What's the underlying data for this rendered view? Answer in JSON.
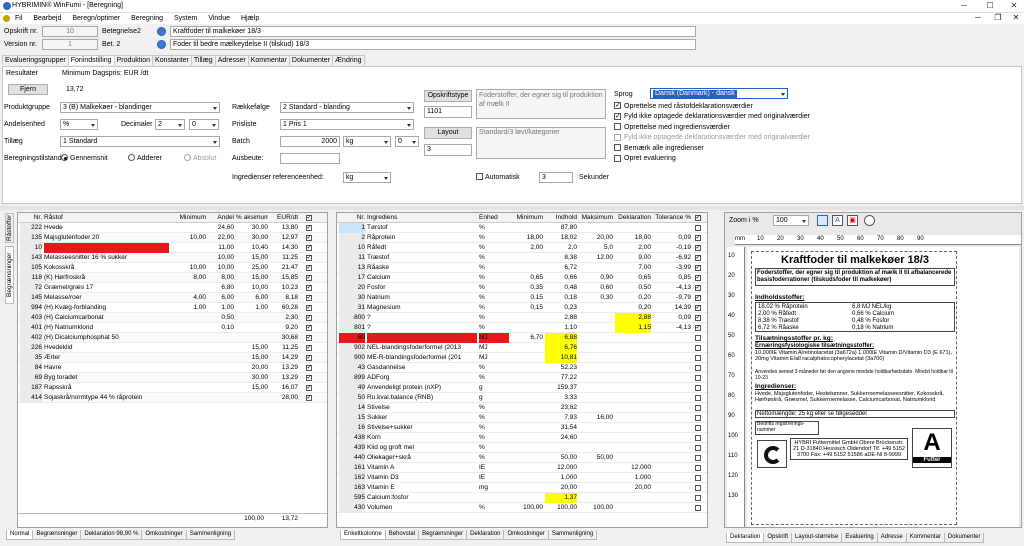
{
  "app": {
    "title": "HYBRIMIN® WinFumi - [Beregning]"
  },
  "menu": [
    "Fil",
    "Bearbejd",
    "Beregn/optimer",
    "Beregning",
    "System",
    "Vindue",
    "Hjælp"
  ],
  "header": {
    "opskrift_label": "Opskrift nr.",
    "opskrift_value": "10",
    "version_label": "Version nr.",
    "version_value": "1",
    "betegnelse2_label": "Betegnelse2",
    "betegnelse2_value": "Kraftfoder til malkekøer 18/3",
    "bet2_label": "Bet. 2",
    "bet2_value": "Foder til bedre mælkeydelse II (tilskud) 18/3"
  },
  "tabs": [
    "Evalueringsgrupper",
    "Foriindstilling",
    "Produktion",
    "Konstanter",
    "Tillæg",
    "Adresser",
    "Kommentar",
    "Dokumenter",
    "Ændring"
  ],
  "results": {
    "resultater_label": "Resultater",
    "min_price_label": "Minimum Dagspris: EUR /dt",
    "fjern_label": "Fjern",
    "price_value": "13,72"
  },
  "settings": {
    "produktgruppe_label": "Produktgruppe",
    "produktgruppe_value": "3 (B) Malkekøer - blandinger",
    "andelsenhed_label": "Andelsenhed",
    "andelsenhed_value": "%",
    "decimaler_label": "Decimaler",
    "decimaler_value": "2",
    "decimaler_value2": "0",
    "tillaeg_label": "Tillæg",
    "tillaeg_value": "1 Standard",
    "beregningstilstand_label": "Beregningstilstand",
    "radio_gennemsnit": "Gennemsnit",
    "radio_adderer": "Adderer",
    "radio_absolut": "Absolut",
    "raekkefolge_label": "Rækkefølge",
    "raekkefolge_value": "2 Standard - blanding",
    "prisliste_label": "Prisliste",
    "prisliste_value": "1 Pris 1",
    "batch_label": "Batch",
    "batch_value": "2000",
    "batch_unit": "kg",
    "batch_extra": "0",
    "ausbeute_label": "Ausbeute:",
    "ingred_ref_label": "Ingredienser referenceenhed:",
    "ingred_ref_value": "kg",
    "opskriftstype_label": "Opskriftstype",
    "opskriftstype_value": "1101",
    "layout_label": "Layout",
    "layout_value": "3",
    "desc1": "Foderstoffer, der egner sig til produktion af mælk II",
    "desc2": "Standard/3 løvt/kategorier",
    "automatisk_label": "Automatisk",
    "sekunder_value": "3",
    "sekunder_label": "Sekunder",
    "sprog_label": "Sprog",
    "sprog_value": "Dansk (Danmark) - dansk",
    "options": [
      {
        "label": "Oprettelse med råstofdeklarationsværdier",
        "checked": true
      },
      {
        "label": "Fyld ikke optagede deklarationsværdier med originalværdier",
        "checked": true
      },
      {
        "label": "Oprettelse med ingrediensværdier",
        "checked": false
      },
      {
        "label": "Fyld ikke optagede deklarationsværdier med originalværdier",
        "checked": false,
        "disabled": true
      },
      {
        "label": "Bemærk alle ingredienser",
        "checked": false
      },
      {
        "label": "Opret evaluering",
        "checked": false
      }
    ]
  },
  "raw_table": {
    "headers": [
      "Nr.",
      "Råstof",
      "Minimum",
      "Andel",
      "% aksimum",
      "EUR/dt"
    ],
    "rows": [
      [
        "222",
        "Hvede",
        "",
        "24,60",
        "30,00",
        "13,80"
      ],
      [
        "135",
        "Majsglutenfoder 20",
        "10,00",
        "22,00",
        "30,00",
        "12,97"
      ],
      [
        "10",
        "",
        "",
        "11,00",
        "10,40",
        "14,30"
      ],
      [
        "143",
        "Melasseesnitter 16 % sukker",
        "",
        "10,00",
        "15,00",
        "11,25"
      ],
      [
        "105",
        "Kokosskrå",
        "10,00",
        "10,00",
        "25,00",
        "21,47"
      ],
      [
        "118",
        "(K) Hørfroskrå",
        "8,00",
        "8,00",
        "15,00",
        "15,85"
      ],
      [
        "72",
        "Græmel/græs 17",
        "",
        "6,80",
        "10,00",
        "10,23"
      ],
      [
        "145",
        "Melasse/roer",
        "4,00",
        "6,00",
        "6,00",
        "8,18"
      ],
      [
        "994",
        "(H) Kvæg-forblanding",
        "1,00",
        "1,00",
        "1,00",
        "60,28"
      ],
      [
        "403",
        "(H) Calciumcarbonat",
        "",
        "0,50",
        "",
        "2,30"
      ],
      [
        "401",
        "(H) Natriumklorid",
        "",
        "0,10",
        "",
        "9,20"
      ],
      [
        "402",
        "(H) Dicalciumphosphat 50",
        "",
        "",
        "",
        "30,68"
      ],
      [
        "226",
        "Hvedeklid",
        "",
        "",
        "15,00",
        "11,25"
      ],
      [
        "35",
        "Ærter",
        "",
        "",
        "15,00",
        "14,29"
      ],
      [
        "84",
        "Havre",
        "",
        "",
        "20,00",
        "13,29"
      ],
      [
        "69",
        "Byg toradet",
        "",
        "",
        "30,00",
        "13,29"
      ],
      [
        "187",
        "Rapsskrå",
        "",
        "",
        "15,00",
        "16,07"
      ],
      [
        "414",
        "Sojaskrå/normtype 44 % råprotein",
        "",
        "",
        "",
        "28,00"
      ]
    ],
    "total_andel": "100,00",
    "total_price": "13,72",
    "bottom_tabs": [
      "Normal",
      "Begrænsninger",
      "Deklaration 98,90 %",
      "Omkostninger",
      "Sammenligning"
    ],
    "side_tabs": [
      "Råstoffer",
      "Begrænsninger"
    ]
  },
  "ingred_table": {
    "headers": [
      "Nr.",
      "Ingrediens",
      "Enhed",
      "Minimum",
      "Indhold",
      "Maksimum",
      "Deklaration",
      "Tolerance %"
    ],
    "rows": [
      [
        "1",
        "Tørstof",
        "%",
        "",
        "87,80",
        "",
        "",
        ""
      ],
      [
        "2",
        "Råprotein",
        "%",
        "18,00",
        "18,02",
        "20,00",
        "18,00",
        "0,09"
      ],
      [
        "10",
        "Råfedt",
        "%",
        "2,00",
        "2,0",
        "5,0",
        "2,00",
        "-0,19"
      ],
      [
        "11",
        "Træstof",
        "%",
        "",
        "8,38",
        "12,00",
        "9,00",
        "-6,92"
      ],
      [
        "13",
        "Råaske",
        "%",
        "",
        "6,72",
        "",
        "7,00",
        "-3,99"
      ],
      [
        "17",
        "Calcium",
        "%",
        "0,65",
        "0,66",
        "0,90",
        "0,65",
        "0,85"
      ],
      [
        "20",
        "Fosfor",
        "%",
        "0,35",
        "0,48",
        "0,60",
        "0,50",
        "-4,13"
      ],
      [
        "30",
        "Natrium",
        "%",
        "0,15",
        "0,18",
        "0,30",
        "0,20",
        "-9,79"
      ],
      [
        "31",
        "Magnesium",
        "%",
        "0,15",
        "0,23",
        "",
        "0,20",
        "14,39"
      ],
      [
        "800",
        "?",
        "%",
        "",
        "2,88",
        "",
        "2,88",
        "0,09"
      ],
      [
        "801",
        "?",
        "%",
        "",
        "1,10",
        "",
        "1,15",
        "-4,13"
      ],
      [
        "80",
        "",
        "MJ",
        "6,70",
        "6,88",
        "",
        "",
        ""
      ],
      [
        "902",
        "NEL-blandingsfoderformel (2013",
        "MJ",
        "",
        "6,76",
        "",
        "",
        ""
      ],
      [
        "900",
        "ME-R-blandingsfoderformel (201",
        "MJ",
        "",
        "10,81",
        "",
        "",
        ""
      ],
      [
        "43",
        "Gasdannelse",
        "%",
        "",
        "52,23",
        "",
        "",
        ""
      ],
      [
        "899",
        "ADForg",
        "%",
        "",
        "77,22",
        "",
        "",
        ""
      ],
      [
        "49",
        "Anvendeligt protein (nXP)",
        "g",
        "",
        "159,37",
        "",
        "",
        ""
      ],
      [
        "50",
        "Ru.kval.balance (RNB)",
        "g",
        "",
        "3,33",
        "",
        "",
        ""
      ],
      [
        "14",
        "Stivelse",
        "%",
        "",
        "23,62",
        "",
        "",
        ""
      ],
      [
        "15",
        "Sukker",
        "%",
        "",
        "7,93",
        "16,00",
        "",
        ""
      ],
      [
        "16",
        "Stivelse+sukker",
        "%",
        "",
        "31,54",
        "",
        "",
        ""
      ],
      [
        "438",
        "Korn",
        "%",
        "",
        "24,60",
        "",
        "",
        ""
      ],
      [
        "439",
        "Klid og groft mel",
        "%",
        "",
        "",
        "",
        "",
        ""
      ],
      [
        "440",
        "Oliekager+skrå",
        "%",
        "",
        "50,00",
        "50,00",
        "",
        ""
      ],
      [
        "161",
        "Vitamin A",
        "IE",
        "",
        "12.000",
        "",
        "12.000",
        ""
      ],
      [
        "162",
        "Vitamin D3",
        "IE",
        "",
        "1.000",
        "",
        "1.000",
        ""
      ],
      [
        "163",
        "Vitamin E",
        "mg",
        "",
        "20,00",
        "",
        "20,00",
        ""
      ],
      [
        "595",
        "Calcium:fosfor",
        "",
        "",
        "1,37",
        "",
        "",
        ""
      ],
      [
        "430",
        "Volumen",
        "%",
        "100,00",
        "100,00",
        "100,00",
        "",
        ""
      ]
    ],
    "bottom_tabs": [
      "Enkeltkolonne",
      "Behovstal",
      "Begrænsninger",
      "Deklaration",
      "Omkostninger",
      "Sammenligning"
    ]
  },
  "preview": {
    "zoom_label": "Zoom i %",
    "zoom_value": "100",
    "ruler_ticks": [
      "10",
      "20",
      "30",
      "40",
      "50",
      "60",
      "70",
      "80",
      "90"
    ],
    "vruler_ticks": [
      "10",
      "20",
      "30",
      "40",
      "50",
      "60",
      "70",
      "80",
      "90",
      "100",
      "110",
      "120",
      "130"
    ],
    "doc": {
      "title": "Kraftfoder til malkekøer 18/3",
      "subtitle": "Foderstoffer, der egner sig til produktion af mælk II til afbalancerede basisfoderrationer (tilskudsfoder til malkekøer)",
      "section1": "Indholdsstoffer:",
      "lines1a": [
        "18,02 % Råprotein",
        "2,00 % Råfedt",
        "8,38 % Træstof",
        "6,72 % Råaske"
      ],
      "lines1b": [
        "6,8 MJ NEL/kg",
        "0,66 % Calcium",
        "0,48 % Fosfor",
        "0,18 % Natrium"
      ],
      "section2": "Tilsætningsstoffer pr. kg:",
      "section3": "Ernæringsfysiologiske tilsætningsstoffer:",
      "vit_text": "10.000IE Vitamin A/retinolacetat (3a672a) 1.000IE Vitamin D/Vitamin D3 (E 671), 20mg Vitamin E/all racalphatocopherylacetat (3a700)",
      "note": "Anvendes senest 3 måneder før den angivne mindste holdbarhedsdato. Mindst holdbar til 10-23",
      "section4": "Ingredienser:",
      "ingredients": "Hvede, Majsglutenfoder, Hestebønner, Sukkerroemelasseesnitter, Kokosskrå, Hørfrøskrå, Græsmel, Sukkerroemelasse, Calciumcarbonat, Natriumklorid",
      "net": "Nettomængde: 25 kg eller se følgeseddel",
      "reg": "Bedrifts registrerings-nummer",
      "company": "HYBRI Futtermittel GmbH Obere Brückenstr. 21 D-31840 Hessisch Oldendorf Tlf. +49 5152 3700 Fax: +49 5152 51586 aDE-NI 8-9999",
      "badge_letter": "A",
      "badge_sub": "Futter"
    },
    "bottom_tabs": [
      "Deklaration",
      "Opskrift",
      "Layout-størrelse",
      "Evaluering",
      "Adresse",
      "Kommentar",
      "Dokumenter"
    ]
  },
  "colors": {
    "highlight_red": "#e8191c",
    "highlight_yellow": "#ffff00",
    "selected_blue": "#1e64c8",
    "nr_blue": "#cce4f7"
  }
}
